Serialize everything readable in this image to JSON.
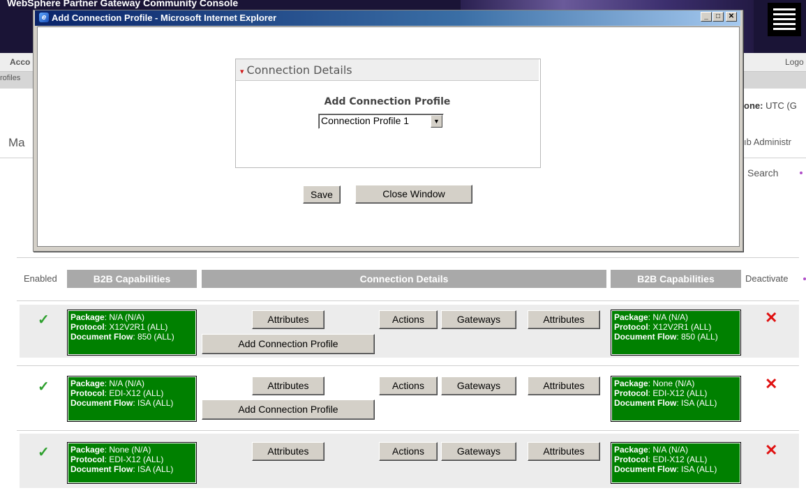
{
  "background": {
    "banner_title": "WebSphere  Partner Gateway Community Console",
    "nav_left": "Acco",
    "nav_right": "Logo",
    "subnav_left": "rofiles",
    "timezone_label": "one:",
    "timezone_value": " UTC (G",
    "page_title": "Ma",
    "hub_admin": "ıb Administr",
    "search": "Search"
  },
  "popup": {
    "title": "Add Connection Profile - Microsoft Internet Explorer",
    "section_title": "Connection Details",
    "field_label": "Add Connection Profile",
    "select_value": "Connection Profile 1",
    "save_label": "Save",
    "close_label": "Close Window"
  },
  "table": {
    "enabled_label": "Enabled",
    "col_b2b_left": "B2B Capabilities",
    "col_connection": "Connection Details",
    "col_b2b_right": "B2B Capabilities",
    "deactivate_label": "Deactivate",
    "rows": [
      {
        "left": {
          "package": "N/A (N/A)",
          "protocol": "X12V2R1 (ALL)",
          "flow": "850 (ALL)"
        },
        "right": {
          "package": "N/A (N/A)",
          "protocol": "X12V2R1 (ALL)",
          "flow": "850 (ALL)"
        },
        "attributes": "Attributes",
        "add_profile": "Add Connection Profile",
        "actions": "Actions",
        "gateways": "Gateways",
        "attributes2": "Attributes"
      },
      {
        "left": {
          "package": "N/A (N/A)",
          "protocol": "EDI-X12 (ALL)",
          "flow": "ISA (ALL)"
        },
        "right": {
          "package": "None (N/A)",
          "protocol": "EDI-X12 (ALL)",
          "flow": "ISA (ALL)"
        },
        "attributes": "Attributes",
        "add_profile": "Add Connection Profile",
        "actions": "Actions",
        "gateways": "Gateways",
        "attributes2": "Attributes"
      },
      {
        "left": {
          "package": "None (N/A)",
          "protocol": "EDI-X12 (ALL)",
          "flow": "ISA (ALL)"
        },
        "right": {
          "package": "N/A (N/A)",
          "protocol": "EDI-X12 (ALL)",
          "flow": "ISA (ALL)"
        },
        "attributes": "Attributes",
        "actions": "Actions",
        "gateways": "Gateways",
        "attributes2": "Attributes"
      }
    ],
    "field_labels": {
      "package": "Package",
      "protocol": "Protocol",
      "flow": "Document Flow"
    }
  }
}
